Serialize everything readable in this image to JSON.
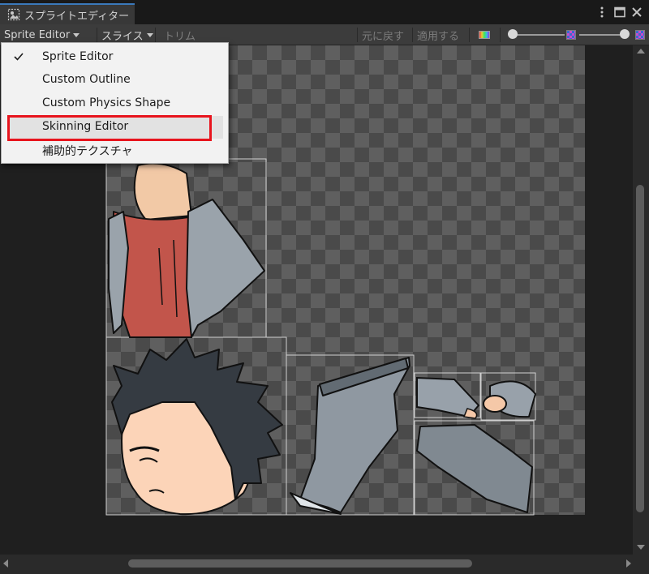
{
  "window": {
    "tab_title": "スプライトエディター",
    "tab_icon": "sprite-editor-icon",
    "controls": [
      "more-options-icon",
      "maximize-icon",
      "close-icon"
    ]
  },
  "toolbar": {
    "mode_dropdown": "Sprite Editor",
    "slice_dropdown": "スライス",
    "trim_label": "トリム",
    "revert_label": "元に戻す",
    "apply_label": "適用する",
    "color_toggle_icon": "rgb-channel-icon",
    "zoom_slider_value": 0,
    "mip_slider_value": 1
  },
  "menu": {
    "items": [
      {
        "label": "Sprite Editor",
        "checked": true
      },
      {
        "label": "Custom Outline",
        "checked": false
      },
      {
        "label": "Custom Physics Shape",
        "checked": false
      },
      {
        "label": "Skinning Editor",
        "checked": false,
        "hovered": true
      },
      {
        "label": "補助的テクスチャ",
        "checked": false
      }
    ]
  },
  "colors": {
    "highlight_box": "#e8141d",
    "accent": "#3a79bb",
    "panel": "#3c3c3c",
    "menu_bg": "#f2f2f2"
  }
}
